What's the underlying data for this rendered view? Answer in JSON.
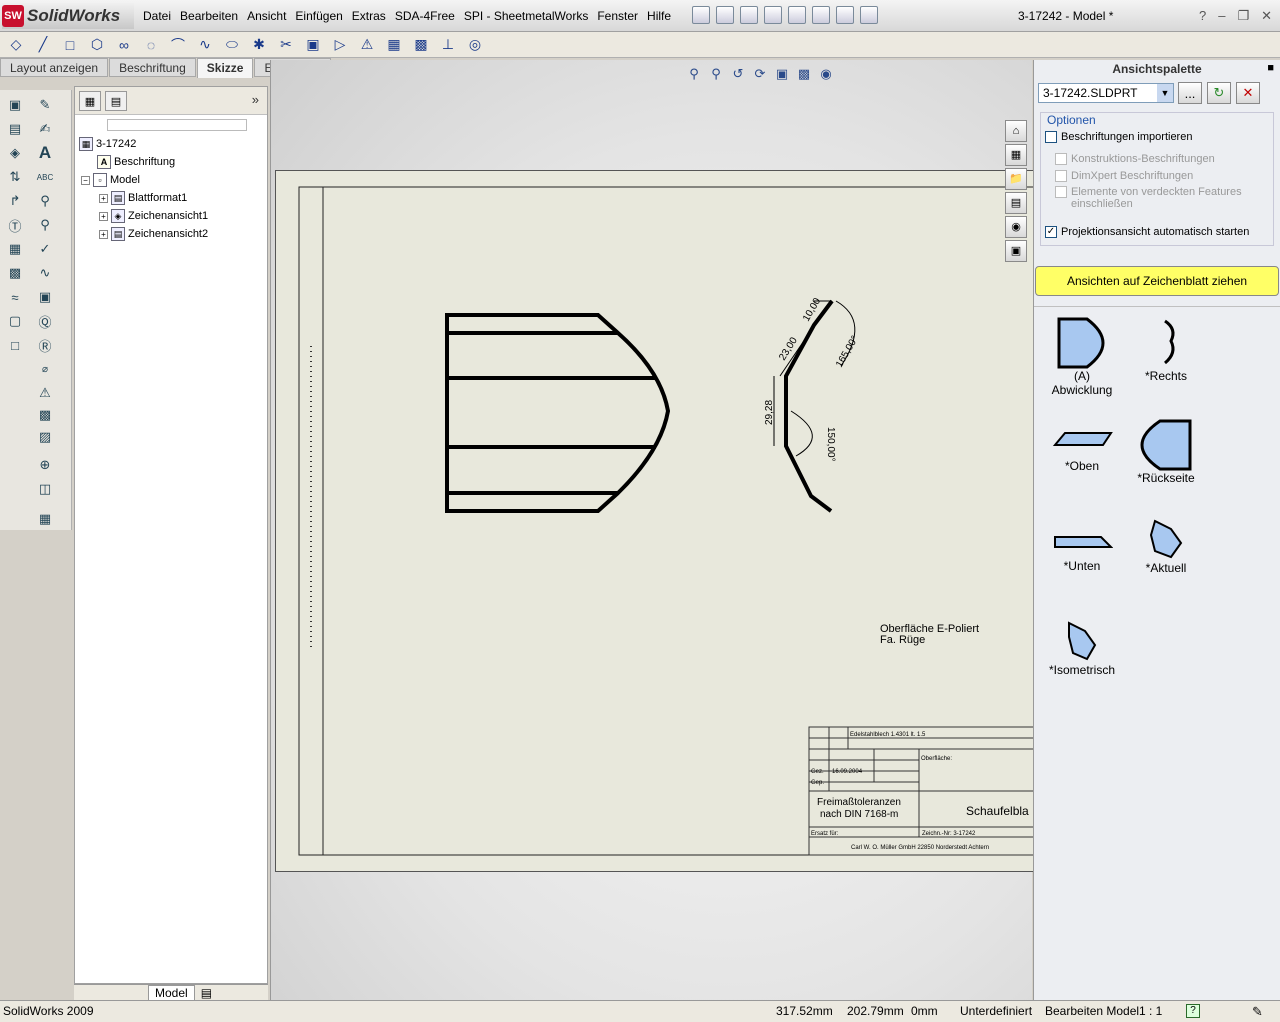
{
  "app": {
    "logo_text": "SolidWorks",
    "logo_abbr": "SW",
    "window_title": "3-17242 - Model *",
    "help_symbol": "?"
  },
  "menu": [
    "Datei",
    "Bearbeiten",
    "Ansicht",
    "Einfügen",
    "Extras",
    "SDA-4Free",
    "SPI - SheetmetalWorks",
    "Fenster",
    "Hilfe"
  ],
  "tabs": [
    {
      "label": "Layout anzeigen"
    },
    {
      "label": "Beschriftung"
    },
    {
      "label": "Skizze"
    },
    {
      "label": "Evaluieren"
    }
  ],
  "tree": {
    "root": "3-17242",
    "items": [
      "Beschriftung",
      "Model",
      "Blattformat1",
      "Zeichenansicht1",
      "Zeichenansicht2"
    ],
    "bottom_tab": "Model"
  },
  "drawing": {
    "note_line1": "Oberfläche E-Poliert",
    "note_line2": "Fa. Rüge",
    "dims": {
      "d1": "10,00",
      "d2": "23,00",
      "d3": "29,28",
      "a1": "165,00°",
      "a2": "150,00°"
    },
    "titleblock": {
      "tolerance_line1": "Freimaßtoleranzen",
      "tolerance_line2": "nach DIN 7168-m",
      "part_name": "Schaufelbla",
      "material": "Edelstahlblech 1.4301 lt. 1.5",
      "surface_label": "Oberfläche:",
      "date": "16.09.2004",
      "row_labels": [
        "Gez.",
        "Gep."
      ],
      "company": "Carl W. O. Müller GmbH 22850 Norderstedt Achtern",
      "drawing_no_label": "Zeichn.-Nr: 3-17242",
      "replaced_label": "Ersatz für:"
    }
  },
  "palette": {
    "title": "Ansichtspalette",
    "file": "3-17242.SLDPRT",
    "browse_label": "...",
    "options_legend": "Optionen",
    "options": [
      {
        "label": "Beschriftungen importieren",
        "checked": false,
        "disabled": false
      },
      {
        "label": "Konstruktions-Beschriftungen",
        "checked": false,
        "disabled": true
      },
      {
        "label": "DimXpert Beschriftungen",
        "checked": false,
        "disabled": true
      },
      {
        "label": "Elemente von verdeckten Features einschließen",
        "checked": false,
        "disabled": true
      },
      {
        "label": "Projektionsansicht automatisch starten",
        "checked": true,
        "disabled": false
      }
    ],
    "drag_banner": "Ansichten auf Zeichenblatt ziehen",
    "views": [
      {
        "label_line1": "(A)",
        "label_line2": "Abwicklung"
      },
      {
        "label_line1": "*Rechts",
        "label_line2": ""
      },
      {
        "label_line1": "*Oben",
        "label_line2": ""
      },
      {
        "label_line1": "*Rückseite",
        "label_line2": ""
      },
      {
        "label_line1": "*Unten",
        "label_line2": ""
      },
      {
        "label_line1": "*Aktuell",
        "label_line2": ""
      },
      {
        "label_line1": "*Isometrisch",
        "label_line2": ""
      }
    ],
    "view_fill": "#a8c8f0"
  },
  "status": {
    "app_version": "SolidWorks 2009",
    "x": "317.52mm",
    "y": "202.79mm",
    "z": "0mm",
    "state": "Unterdefiniert",
    "mode": "Bearbeiten Model",
    "scale": "1 : 1"
  }
}
